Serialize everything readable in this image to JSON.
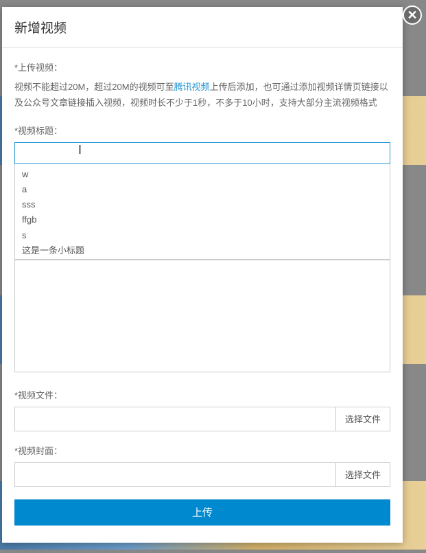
{
  "modal": {
    "title": "新增视频",
    "close": "✕"
  },
  "upload_video": {
    "label": "*上传视频：",
    "help_pre": "视频不能超过20M，超过20M的视频可至",
    "help_link": "腾讯视频",
    "help_post": "上传后添加，也可通过添加视频详情页链接以及公众号文章链接插入视频，视频时长不少于1秒，不多于10小时，支持大部分主流视频格式"
  },
  "video_title": {
    "label": "*视频标题：",
    "value": "",
    "suggestions": [
      "w",
      "a",
      "sss",
      "ffgb",
      "s",
      "这是一条小标题"
    ]
  },
  "video_file": {
    "label": "*视频文件：",
    "button": "选择文件",
    "value": ""
  },
  "video_cover": {
    "label": "*视频封面：",
    "button": "选择文件",
    "value": ""
  },
  "submit": {
    "label": "上传"
  }
}
